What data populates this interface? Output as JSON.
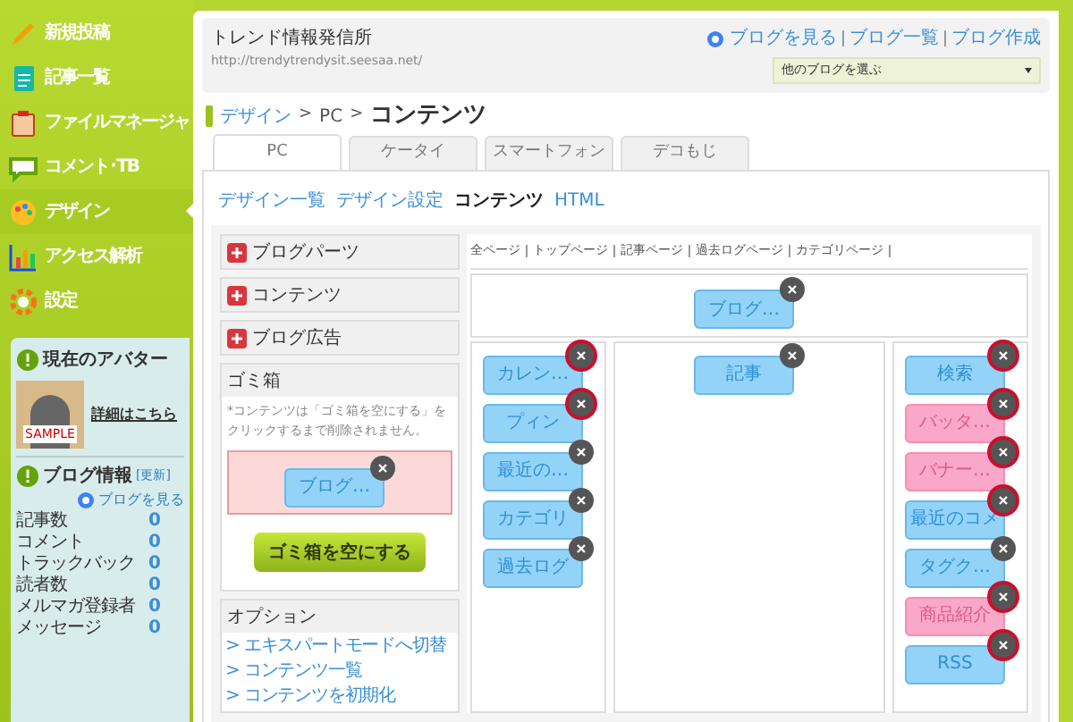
{
  "sidebar": {
    "items": [
      {
        "label": "新規投稿",
        "selected": false
      },
      {
        "label": "記事一覧",
        "selected": false
      },
      {
        "label": "ファイルマネージャ",
        "selected": false
      },
      {
        "label": "コメント･TB",
        "selected": false
      },
      {
        "label": "デザイン",
        "selected": true
      },
      {
        "label": "アクセス解析",
        "selected": false
      },
      {
        "label": "設定",
        "selected": false
      }
    ],
    "avatar": {
      "title": "現在のアバター",
      "badge": "SAMPLE",
      "link": "詳細はこちら"
    },
    "blog_info": {
      "title": "ブログ情報",
      "update": "[更新]",
      "view": "ブログを見る",
      "stats": [
        {
          "label": "記事数",
          "value": "0"
        },
        {
          "label": "コメント",
          "value": "0"
        },
        {
          "label": "トラックバック",
          "value": "0"
        },
        {
          "label": "読者数",
          "value": "0"
        },
        {
          "label": "メルマガ登録者",
          "value": "0"
        },
        {
          "label": "メッセージ",
          "value": "0"
        }
      ]
    }
  },
  "header": {
    "blog_name": "トレンド情報発信所",
    "url": "http://trendytrendysit.seesaa.net/",
    "links": [
      "ブログを見る",
      "ブログ一覧",
      "ブログ作成"
    ],
    "select": "他のブログを選ぶ"
  },
  "breadcrumb": {
    "items": [
      "デザイン",
      "PC"
    ],
    "separator": ">",
    "current": "コンテンツ"
  },
  "tabs": [
    {
      "label": "PC",
      "selected": true
    },
    {
      "label": "ケータイ",
      "selected": false
    },
    {
      "label": "スマートフォン",
      "selected": false
    },
    {
      "label": "デコもじ",
      "selected": false
    }
  ],
  "subnav": [
    {
      "label": "デザイン一覧",
      "selected": false
    },
    {
      "label": "デザイン設定",
      "selected": false
    },
    {
      "label": "コンテンツ",
      "selected": true
    },
    {
      "label": "HTML",
      "selected": false
    }
  ],
  "panels": [
    "ブログパーツ",
    "コンテンツ",
    "ブログ広告"
  ],
  "trash": {
    "title": "ゴミ箱",
    "note": "*コンテンツは「ゴミ箱を空にする」をクリックするまで削除されません。",
    "part": {
      "label": "ブログ…",
      "kind": "blue",
      "highlighted": false
    },
    "button": "ゴミ箱を空にする"
  },
  "options": {
    "title": "オプション",
    "links": [
      "> エキスパートモードへ切替",
      "> コンテンツ一覧",
      "> コンテンツを初期化"
    ]
  },
  "page_filters": [
    "全ページ",
    "トップページ",
    "記事ページ",
    "過去ログページ",
    "カテゴリページ"
  ],
  "layout": {
    "top": [
      {
        "label": "ブログ…",
        "kind": "blue",
        "highlighted": false
      }
    ],
    "left": [
      {
        "label": "カレン…",
        "kind": "blue",
        "highlighted": true
      },
      {
        "label": "プィン",
        "kind": "blue",
        "highlighted": true
      },
      {
        "label": "最近の…",
        "kind": "blue",
        "highlighted": false
      },
      {
        "label": "カテゴリ",
        "kind": "blue",
        "highlighted": false
      },
      {
        "label": "過去ログ",
        "kind": "blue",
        "highlighted": false
      }
    ],
    "center": [
      {
        "label": "記事",
        "kind": "blue",
        "highlighted": false
      }
    ],
    "right": [
      {
        "label": "検索",
        "kind": "blue",
        "highlighted": true
      },
      {
        "label": "バッタ…",
        "kind": "pink",
        "highlighted": true
      },
      {
        "label": "バナー…",
        "kind": "pink",
        "highlighted": true
      },
      {
        "label": "最近のコメ",
        "kind": "blue",
        "highlighted": true
      },
      {
        "label": "タグク…",
        "kind": "blue",
        "highlighted": false
      },
      {
        "label": "商品紹介",
        "kind": "pink",
        "highlighted": true
      },
      {
        "label": "RSS",
        "kind": "blue",
        "highlighted": true
      }
    ]
  }
}
